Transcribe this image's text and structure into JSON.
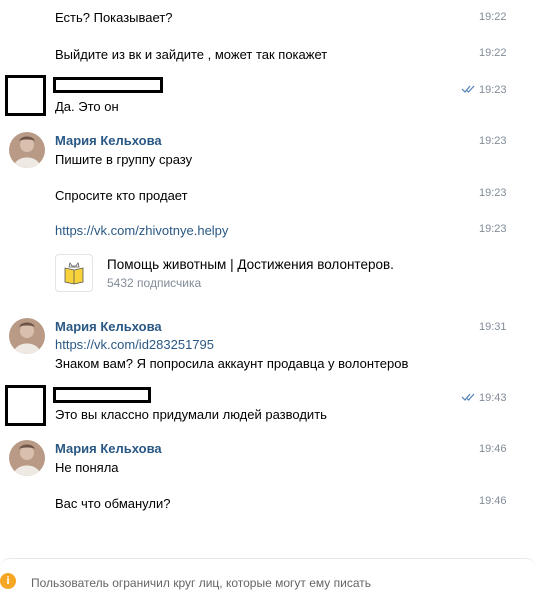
{
  "colors": {
    "author": "#2a5885",
    "link": "#2a5885",
    "time": "#818c99",
    "info_icon": "#f5a623"
  },
  "messages": {
    "m1": {
      "text": "Есть? Показывает?",
      "time": "19:22"
    },
    "m2": {
      "text": "Выйдите из вк и зайдите , может так покажет",
      "time": "19:22"
    },
    "m3": {
      "text": "Да. Это он",
      "time": "19:23",
      "status_icon": "double-check-icon"
    },
    "m4": {
      "author": "Мария Кельхова",
      "text": "Пишите в группу сразу",
      "time": "19:23"
    },
    "m5": {
      "text": "Спросите кто продает",
      "time": "19:23"
    },
    "m6": {
      "link": "https://vk.com/zhivotnye.helpy",
      "time": "19:23"
    },
    "group": {
      "name": "Помощь животным | Достижения волонтеров.",
      "subscribers": "5432 подписчика"
    },
    "m7": {
      "author": "Мария Кельхова",
      "link": "https://vk.com/id283251795",
      "text": "Знаком вам? Я попросила аккаунт продавца у волонтеров",
      "time": "19:31"
    },
    "m8": {
      "text": "Это вы классно придумали людей разводить",
      "time": "19:43",
      "status_icon": "double-check-icon"
    },
    "m9": {
      "author": "Мария Кельхова",
      "text": "Не поняла",
      "time": "19:46"
    },
    "m10": {
      "text": "Вас что обманули?",
      "time": "19:46"
    }
  },
  "footer": {
    "icon": "info-icon",
    "notice": "Пользователь ограничил круг лиц, которые могут ему писать"
  }
}
